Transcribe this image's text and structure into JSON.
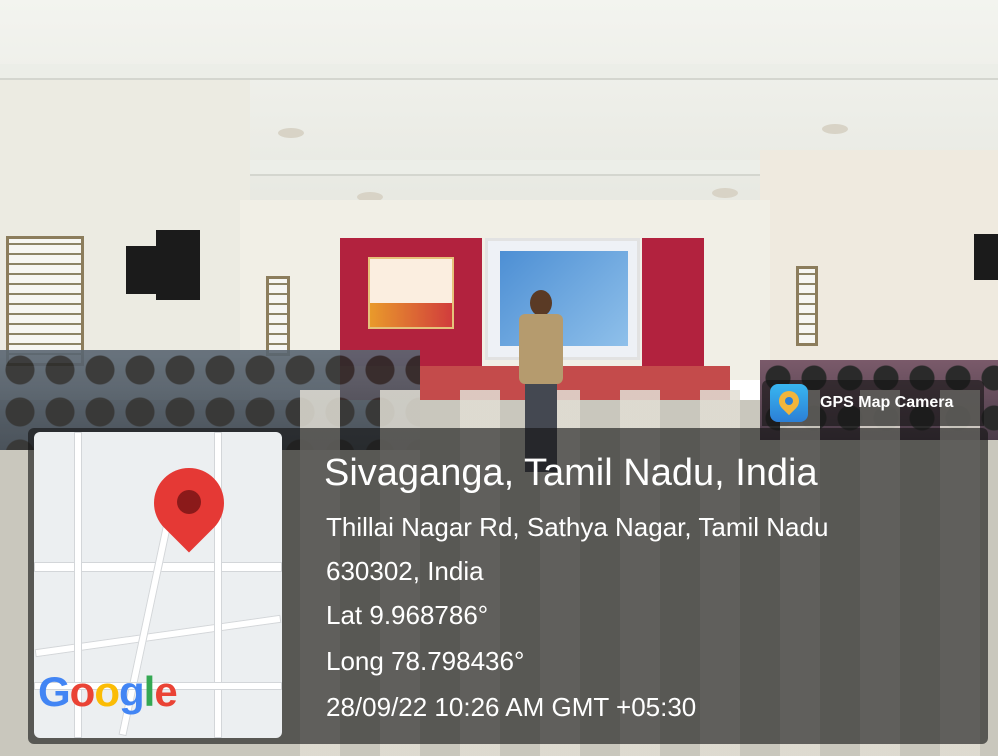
{
  "app": {
    "name": "GPS Map Camera",
    "icon": "gps-map-camera-icon"
  },
  "map": {
    "logo_text": "Google",
    "logo_colors": [
      "#4285F4",
      "#EA4335",
      "#FBBC05",
      "#4285F4",
      "#34A853",
      "#EA4335"
    ],
    "pin_icon": "map-pin-icon",
    "pin_color": "#E53935"
  },
  "location": {
    "title": "Sivaganga, Tamil Nadu, India",
    "address_line1": "Thillai Nagar Rd, Sathya Nagar, Tamil Nadu",
    "address_line2": "630302, India",
    "lat": "Lat 9.968786°",
    "long": "Long 78.798436°",
    "datetime": "28/09/22 10:26 AM GMT +05:30"
  }
}
